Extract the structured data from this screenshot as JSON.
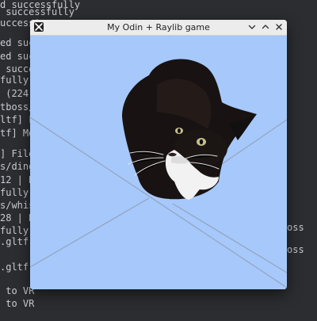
{
  "terminal": {
    "lines": [
      "d successfully",
      " successfully",
      "uccess'",
      "ed succ",
      "ed succ",
      " succe",
      "fully",
      " (224",
      "tboss/",
      "ltf] F",
      "tf] Mo",
      "",
      "] File",
      "s/ding",
      "12 | R",
      "fully",
      "s/whis",
      "28 | R",
      "fully",
      ".gltf]",
      "",
      ".gltf]",
      "",
      " to VR",
      " to VR"
    ],
    "right_fragments": [
      "oss",
      "oss"
    ]
  },
  "window": {
    "title": "My Odin + Raylib game",
    "icons": {
      "app": "x11-icon",
      "minimize": "chevron-down-icon",
      "maximize": "chevron-up-icon",
      "close": "close-icon"
    },
    "viewport_color": "#a6c8fb",
    "scene": {
      "subject": "cat-model"
    }
  }
}
